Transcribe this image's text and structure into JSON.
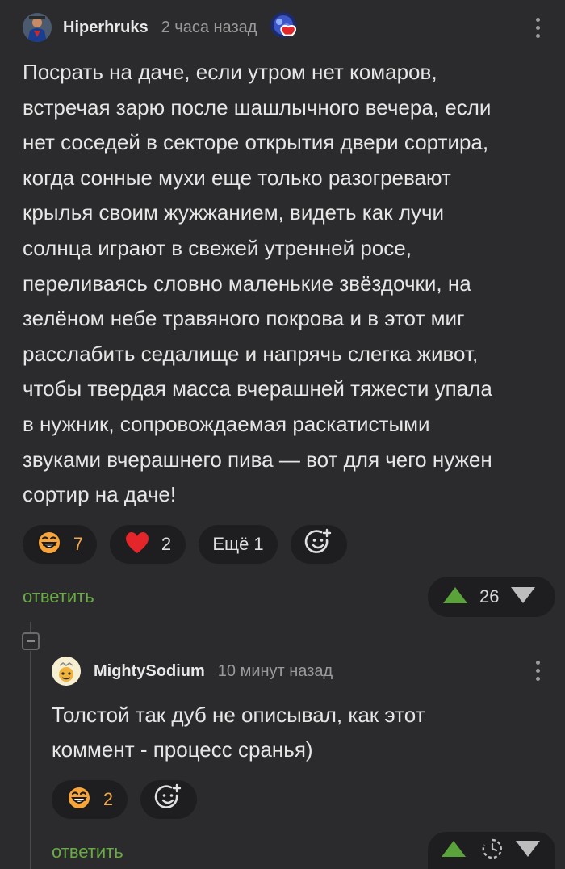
{
  "comment1": {
    "author": "Hiperhruks",
    "time": "2 часа назад",
    "text": "Посрать на даче, если утром нет комаров,\nвстречая зарю после шашлычного вечера, если\nнет соседей в секторе открытия двери сортира,\nкогда сонные мухи еще только разогревают\nкрылья своим жужжанием, видеть как лучи\nсолнца играют в свежей утренней росе,\nпереливаясь словно маленькие звёздочки, на\nзелёном небе травяного покрова и в этот миг\nрасслабить седалище и напрячь слегка живот,\nчтобы твердая масса вчерашней тяжести упала\nв нужник, сопровождаемая раскатистыми\nзвуками вчерашнего пива — вот для чего нужен\nсортир на даче!",
    "reactions": {
      "laugh_count": "7",
      "heart_count": "2",
      "more_label": "Ещё 1"
    },
    "reply_label": "ответить",
    "rating": "26"
  },
  "comment2": {
    "author": "MightySodium",
    "time": "10 минут назад",
    "text": "Толстой так дуб не описывал, как этот\nкоммент - процесс сранья)",
    "reactions": {
      "laugh_count": "2"
    },
    "reply_label": "ответить"
  },
  "colors": {
    "background": "#2b2b2d",
    "pill": "#1e1e20",
    "reply_green": "#6aab45",
    "upvote_green": "#5aa33b",
    "count_orange": "#f2a74a",
    "heart_red": "#e4262b"
  },
  "icons": {
    "laugh": "laughing-face-emoji",
    "heart": "heart",
    "add_reaction": "smiley-plus",
    "upvote": "triangle-up",
    "downvote": "triangle-down",
    "more": "vertical-dots",
    "collapse": "minus-square",
    "timer": "clock-dashed"
  }
}
